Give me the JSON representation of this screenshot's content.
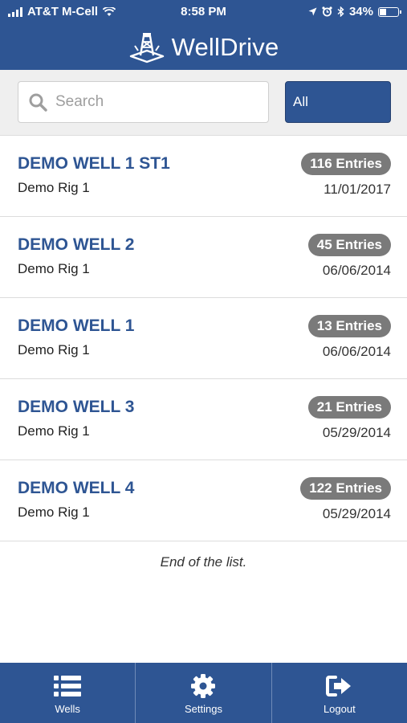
{
  "status_bar": {
    "carrier": "AT&T M-Cell",
    "time": "8:58 PM",
    "battery": "34%",
    "battery_level": 0.34
  },
  "header": {
    "brand": "WellDrive"
  },
  "search": {
    "placeholder": "Search",
    "value": "",
    "filter_label": "All"
  },
  "wells": [
    {
      "name": "DEMO WELL 1 ST1",
      "rig": "Demo Rig 1",
      "entries": "116 Entries",
      "date": "11/01/2017"
    },
    {
      "name": "DEMO WELL 2",
      "rig": "Demo Rig 1",
      "entries": "45 Entries",
      "date": "06/06/2014"
    },
    {
      "name": "DEMO WELL 1",
      "rig": "Demo Rig 1",
      "entries": "13 Entries",
      "date": "06/06/2014"
    },
    {
      "name": "DEMO WELL 3",
      "rig": "Demo Rig 1",
      "entries": "21 Entries",
      "date": "05/29/2014"
    },
    {
      "name": "DEMO WELL 4",
      "rig": "Demo Rig 1",
      "entries": "122 Entries",
      "date": "05/29/2014"
    }
  ],
  "list_footer": "End of the list.",
  "tabs": [
    {
      "label": "Wells",
      "icon": "list-icon"
    },
    {
      "label": "Settings",
      "icon": "gear-icon"
    },
    {
      "label": "Logout",
      "icon": "logout-icon"
    }
  ],
  "colors": {
    "primary": "#2e5593",
    "badge": "#7a7a7a"
  }
}
